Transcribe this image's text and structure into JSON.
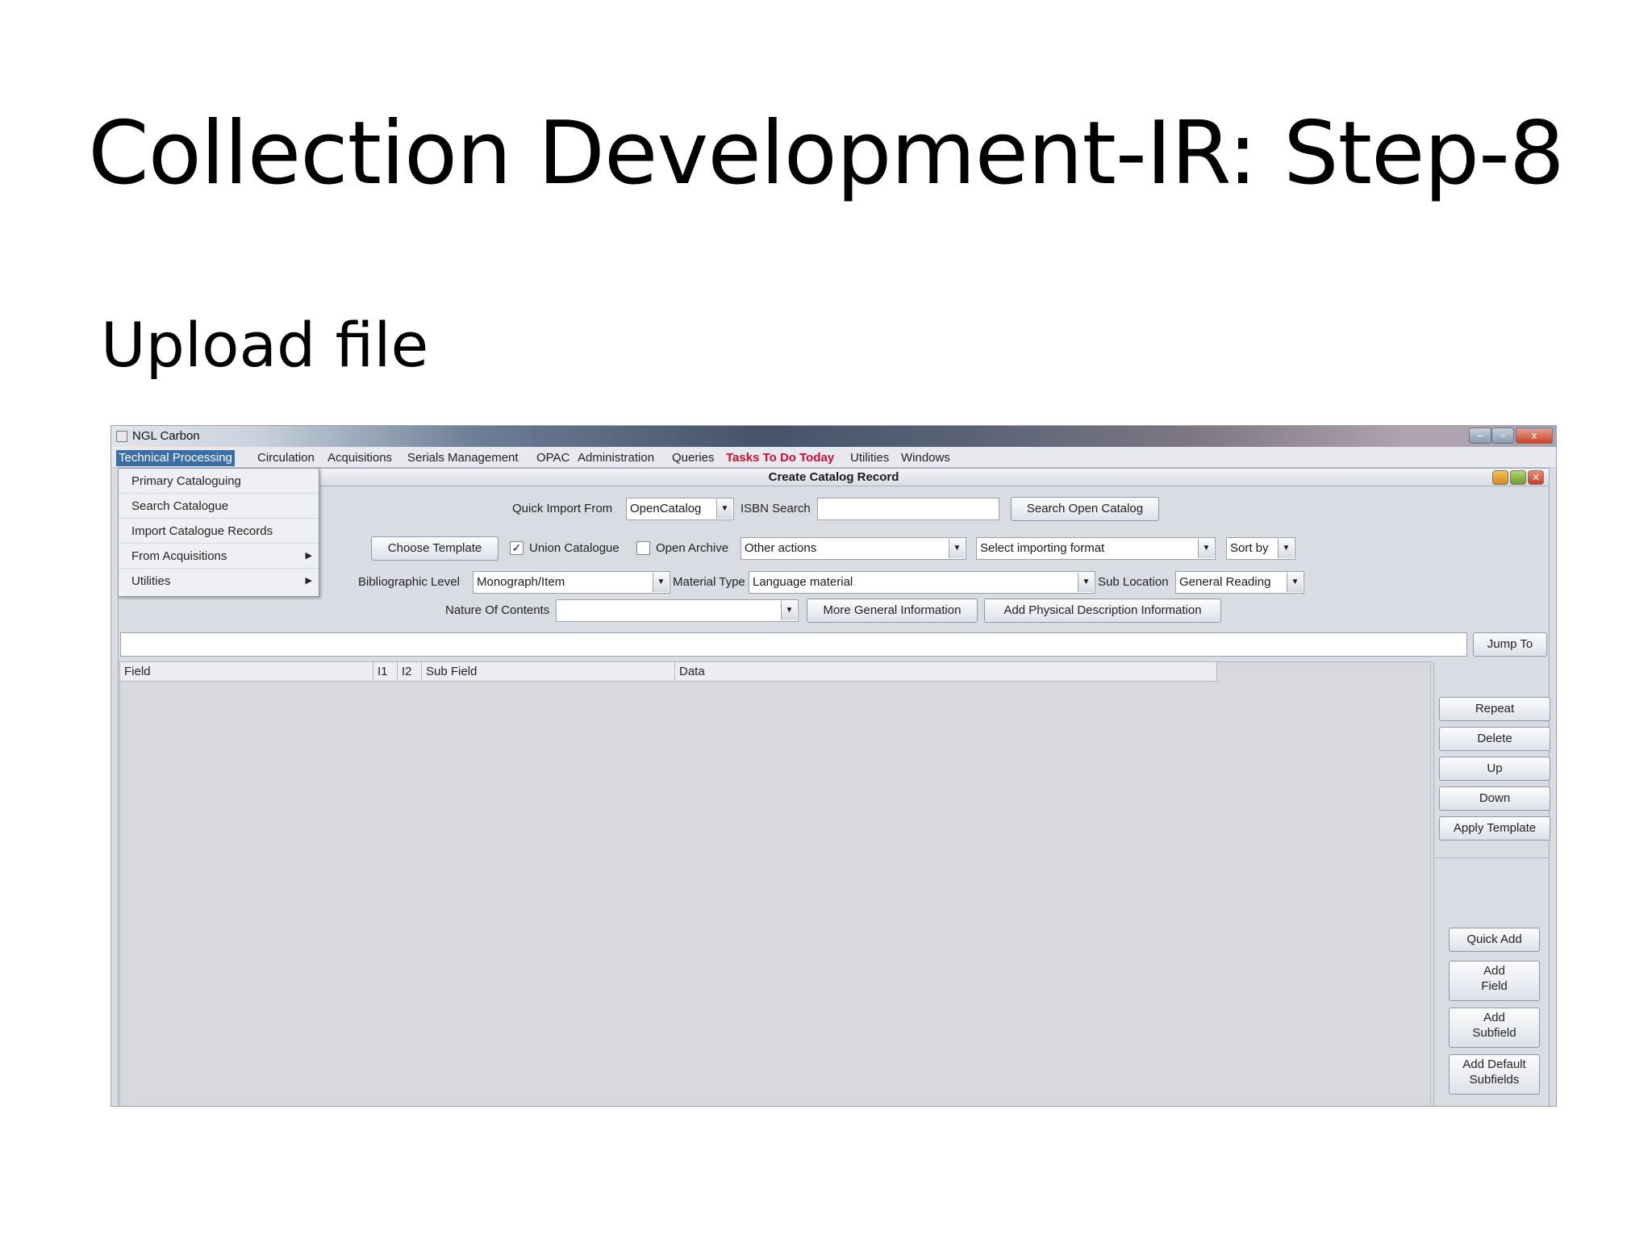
{
  "slide": {
    "title": "Collection Development-IR: Step-8",
    "subtitle": "Upload file"
  },
  "window": {
    "title": "NGL Carbon",
    "controls": {
      "minimize": "–",
      "maximize": "▫",
      "close": "x"
    }
  },
  "menubar": {
    "items": [
      "Technical Processing",
      "Circulation",
      "Acquisitions",
      "Serials Management",
      "OPAC",
      "Administration",
      "Queries",
      "Tasks To Do Today",
      "Utilities",
      "Windows"
    ]
  },
  "dropdown": {
    "items": [
      "Primary Cataloguing",
      "Search Catalogue",
      "Import Catalogue Records",
      "From Acquisitions",
      "Utilities"
    ],
    "submenu_arrow": "▶"
  },
  "form": {
    "title": "Create Catalog Record",
    "quick_import_label": "Quick Import From",
    "quick_import_value": "OpenCatalog",
    "isbn_label": "ISBN Search",
    "search_open_catalog": "Search Open Catalog",
    "choose_template": "Choose Template",
    "union_catalogue": "Union Catalogue",
    "union_checked": "✓",
    "open_archive": "Open Archive",
    "other_actions": "Other actions",
    "import_format": "Select importing format",
    "sort_by": "Sort by",
    "bib_level_label": "Bibliographic Level",
    "bib_level_value": "Monograph/Item",
    "material_type_label": "Material Type",
    "material_type_value": "Language material",
    "sub_location_label": "Sub Location",
    "sub_location_value": "General Reading",
    "nature_label": "Nature Of Contents",
    "more_general": "More General Information",
    "add_physical": "Add Physical Description Information",
    "jump_to": "Jump To",
    "combo_arrow": "▼"
  },
  "grid": {
    "columns": [
      "Field",
      "I1",
      "I2",
      "Sub Field",
      "Data"
    ]
  },
  "side_buttons": {
    "repeat": "Repeat",
    "delete": "Delete",
    "up": "Up",
    "down": "Down",
    "apply_template": "Apply Template",
    "quick_add": "Quick Add",
    "add_field_1": "Add",
    "add_field_2": "Field",
    "add_subfield_1": "Add",
    "add_subfield_2": "Subfield",
    "add_default_1": "Add Default",
    "add_default_2": "Subfields"
  }
}
